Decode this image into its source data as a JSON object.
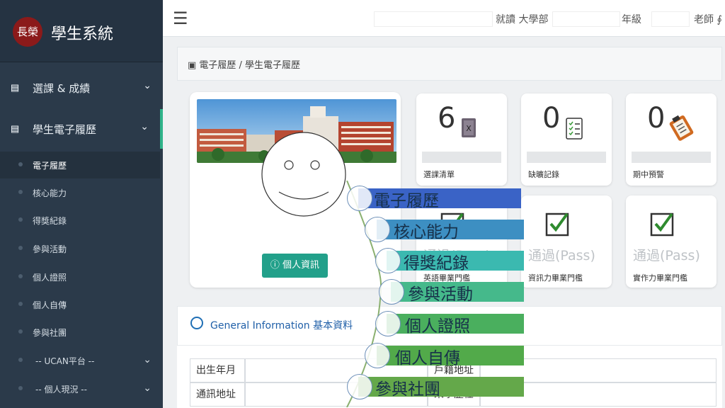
{
  "sidebar": {
    "logo_text": "長榮",
    "brand_title": "學生系統",
    "menu1": {
      "icon": "id-card-icon",
      "label": "選課 & 成績"
    },
    "menu2": {
      "icon": "id-card-icon",
      "label": "學生電子履歷"
    },
    "subitems": [
      {
        "label": "電子履歷",
        "active": true
      },
      {
        "label": "核心能力"
      },
      {
        "label": "得獎紀錄"
      },
      {
        "label": "參與活動"
      },
      {
        "label": "個人證照"
      },
      {
        "label": "個人自傳"
      },
      {
        "label": "參與社團"
      },
      {
        "label": "-- UCAN平台 --"
      },
      {
        "label": "-- 個人現況 --"
      }
    ]
  },
  "topbar": {
    "dept_label": "就讀 大學部",
    "grade_label": "年級",
    "teacher_label": "老師 ∮"
  },
  "breadcrumb": "▣ 電子履歷 / 學生電子履歷",
  "profile": {
    "info_button": "ⓘ 個人資訊"
  },
  "cards_top": [
    {
      "num": "6",
      "caption": "選課清單",
      "icon": "book-icon"
    },
    {
      "num": "0",
      "caption": "缺曠記錄",
      "icon": "checklist-icon"
    },
    {
      "num": "0",
      "caption": "期中預警",
      "icon": "clipboard-icon"
    }
  ],
  "cards_bottom": [
    {
      "status": "通過(Pass)",
      "caption": "英語畢業門檻"
    },
    {
      "status": "通過(Pass)",
      "caption": "資訊力畢業門檻"
    },
    {
      "status": "通過(Pass)",
      "caption": "實作力畢業門檻"
    }
  ],
  "general": {
    "title": "General Information 基本資料"
  },
  "table": {
    "rows": [
      {
        "label1": "出生年月",
        "label2": "戶籍地址"
      },
      {
        "label1": "通訊地址",
        "label2": "來學歷任"
      }
    ]
  },
  "timeline": {
    "items": [
      "電子履歷",
      "核心能力",
      "得獎紀錄",
      "參與活動",
      "個人證照",
      "個人自傳",
      "參與社團"
    ],
    "colors": [
      "#3a63c6",
      "#3d8fc2",
      "#3bb9b0",
      "#45b98b",
      "#4aaf5e",
      "#52aa4a",
      "#64a84a"
    ]
  },
  "colors": {
    "sidebar_bg": "#2b3a4a",
    "accent": "#2fb38a",
    "info_btn": "#22a08a",
    "link": "#1f5fa8"
  }
}
